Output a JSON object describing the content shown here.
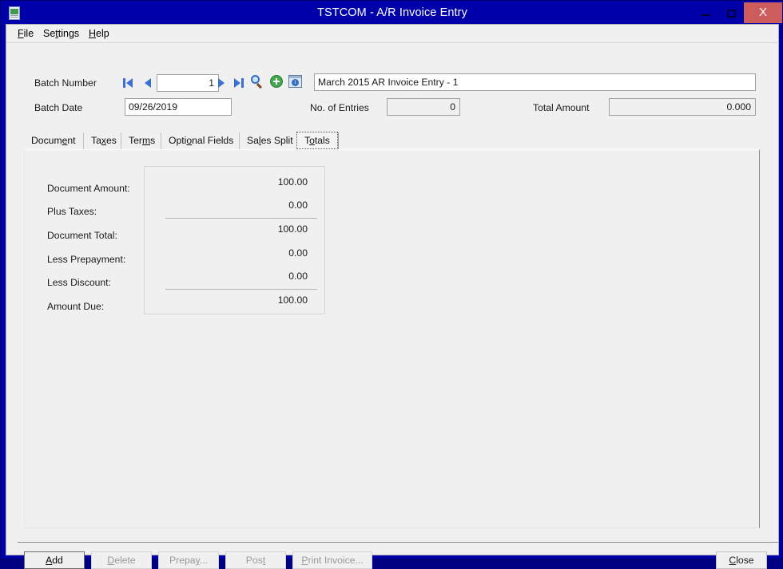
{
  "window": {
    "title": "TSTCOM - A/R Invoice Entry",
    "icon": "document-grid-icon",
    "minimize_label": "",
    "maximize_label": "",
    "close_label": "X",
    "titlebar_color": "#0000aa",
    "close_button_color": "#cd5c5c"
  },
  "menubar": {
    "items": [
      {
        "label": "File",
        "accel": "F"
      },
      {
        "label": "Settings",
        "accel": "t"
      },
      {
        "label": "Help",
        "accel": "H"
      }
    ]
  },
  "header": {
    "batch_number_label": "Batch Number",
    "batch_number_value": "1",
    "batch_date_label": "Batch Date",
    "batch_date_value": "09/26/2019",
    "description_value": "March 2015 AR Invoice Entry - 1",
    "no_of_entries_label": "No. of Entries",
    "no_of_entries_value": "0",
    "total_amount_label": "Total Amount",
    "total_amount_value": "0.000",
    "nav": {
      "first": "first-record-icon",
      "prev": "previous-record-icon",
      "next": "next-record-icon",
      "last": "last-record-icon",
      "search": "search-icon",
      "new": "new-record-icon",
      "info": "batch-info-icon"
    }
  },
  "tabs": [
    {
      "label": "Document",
      "accel_index": 5,
      "active": false
    },
    {
      "label": "Taxes",
      "accel_index": 2,
      "active": false
    },
    {
      "label": "Terms",
      "accel_index": 3,
      "active": false
    },
    {
      "label": "Optional Fields",
      "accel_index": 4,
      "active": false
    },
    {
      "label": "Sales Split",
      "accel_index": 2,
      "active": false
    },
    {
      "label": "Totals",
      "accel_index": 1,
      "active": true
    }
  ],
  "totals": {
    "rows": [
      {
        "label": "Document Amount:",
        "value": "100.00",
        "rule_above": false
      },
      {
        "label": "Plus Taxes:",
        "value": "0.00",
        "rule_above": false
      },
      {
        "label": "Document Total:",
        "value": "100.00",
        "rule_above": true
      },
      {
        "label": "Less Prepayment:",
        "value": "0.00",
        "rule_above": false
      },
      {
        "label": "Less Discount:",
        "value": "0.00",
        "rule_above": false
      },
      {
        "label": "Amount Due:",
        "value": "100.00",
        "rule_above": true
      }
    ]
  },
  "footer": {
    "buttons": [
      {
        "id": "add",
        "label": "Add",
        "accel": "A",
        "state": "default"
      },
      {
        "id": "delete",
        "label": "Delete",
        "accel": "D",
        "state": "disabled"
      },
      {
        "id": "prepay",
        "label": "Prepay...",
        "accel": "y",
        "state": "disabled"
      },
      {
        "id": "post",
        "label": "Post",
        "accel": "t",
        "state": "disabled"
      },
      {
        "id": "print",
        "label": "Print Invoice...",
        "accel": "P",
        "state": "disabled"
      }
    ],
    "close": {
      "label": "Close",
      "accel": "C"
    }
  }
}
